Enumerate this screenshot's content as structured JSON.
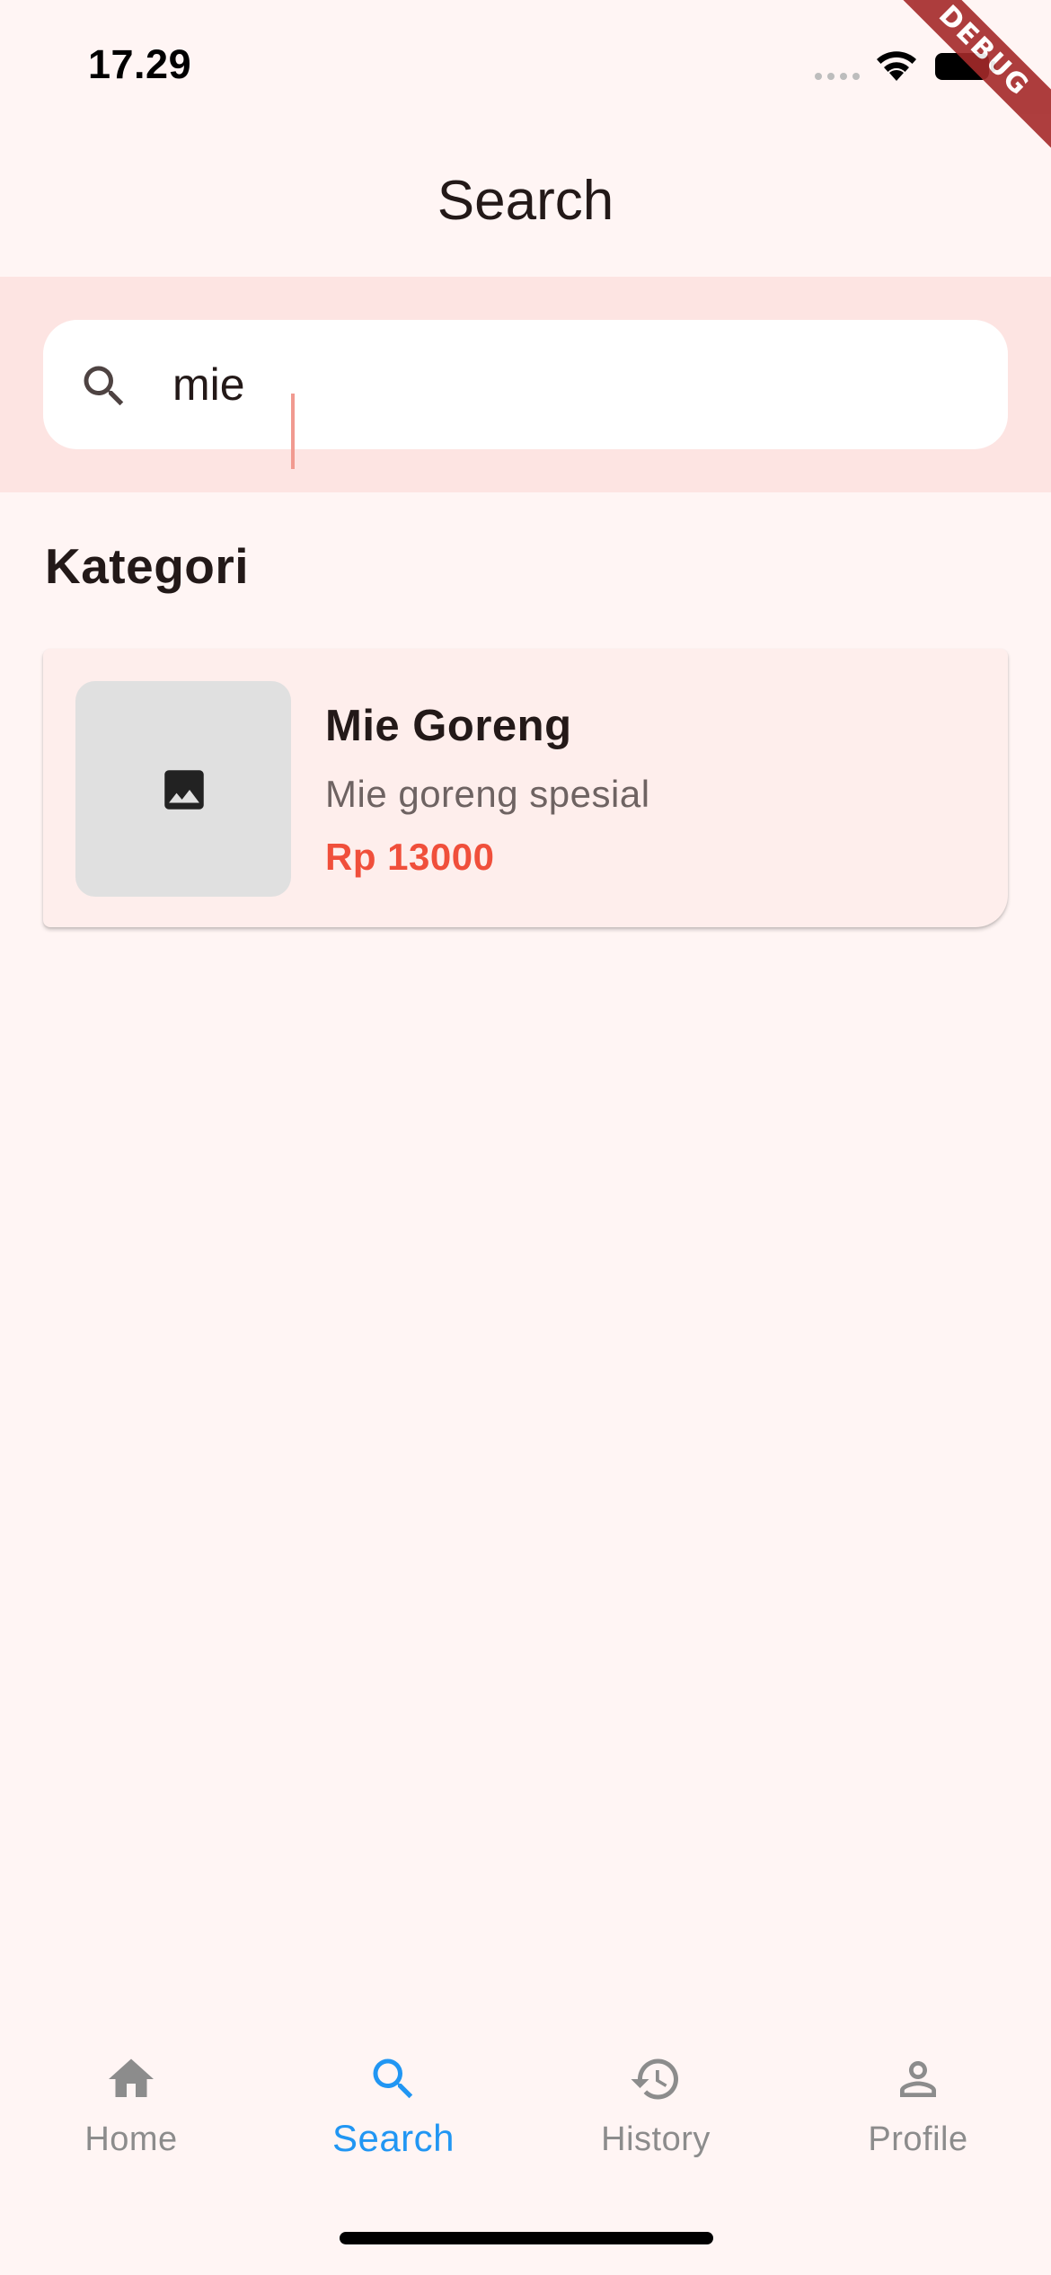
{
  "status_bar": {
    "time": "17.29",
    "icons": [
      "signal-icon",
      "wifi-icon",
      "battery-icon"
    ]
  },
  "debug_banner": "DEBUG",
  "header": {
    "title": "Search"
  },
  "search": {
    "value": "mie",
    "icon": "search-icon"
  },
  "section": {
    "title": "Kategori"
  },
  "results": [
    {
      "name": "Mie Goreng",
      "description": "Mie goreng spesial",
      "price": "Rp 13000",
      "image_icon": "image-icon"
    }
  ],
  "bottom_nav": {
    "active": "Search",
    "items": [
      {
        "label": "Home",
        "icon": "home-icon"
      },
      {
        "label": "Search",
        "icon": "search-icon"
      },
      {
        "label": "History",
        "icon": "history-icon"
      },
      {
        "label": "Profile",
        "icon": "person-icon"
      }
    ]
  },
  "colors": {
    "background": "#fff5f4",
    "search_band": "#fde4e2",
    "card": "#feeeec",
    "price": "#f04f3b",
    "nav_active": "#2196f3",
    "nav_inactive": "#8c8c8c",
    "debug_banner": "#a52a2a"
  }
}
